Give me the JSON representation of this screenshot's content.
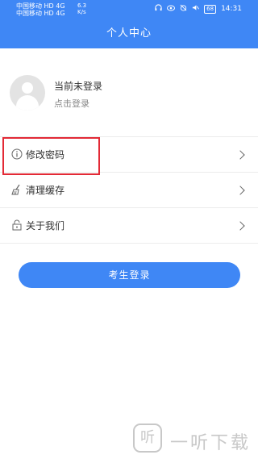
{
  "status_bar": {
    "carrier1": "中国移动 HD 4G",
    "carrier2": "中国移动 HD 4G",
    "speed": "6.3",
    "speed_unit": "K/s",
    "battery": "68",
    "time": "14:31"
  },
  "header": {
    "title": "个人中心"
  },
  "profile": {
    "name": "当前未登录",
    "sub": "点击登录"
  },
  "menu": [
    {
      "label": "修改密码",
      "icon": "info-icon"
    },
    {
      "label": "清理缓存",
      "icon": "broom-icon"
    },
    {
      "label": "关于我们",
      "icon": "lock-icon"
    }
  ],
  "login_button": {
    "label": "考生登录"
  },
  "watermark": {
    "logo": "听",
    "text": "一听下载"
  },
  "colors": {
    "brand": "#3f87f5",
    "highlight": "#e32a36"
  }
}
